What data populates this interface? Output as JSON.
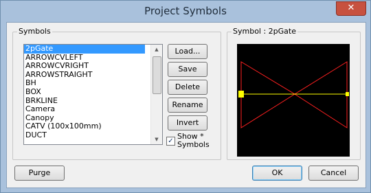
{
  "window": {
    "title": "Project Symbols",
    "close_glyph": "✕"
  },
  "symbols_group": {
    "label": "Symbols",
    "items": [
      "2pGate",
      "ARROWCVLEFT",
      "ARROWCVRIGHT",
      "ARROWSTRAIGHT",
      "BH",
      "BOX",
      "BRKLINE",
      "Camera",
      "Canopy",
      "CATV (100x100mm)",
      "DUCT"
    ],
    "selected": "2pGate"
  },
  "buttons": {
    "load": "Load...",
    "save": "Save",
    "delete": "Delete",
    "rename": "Rename",
    "invert": "Invert",
    "purge": "Purge",
    "ok": "OK",
    "cancel": "Cancel"
  },
  "show_symbols": {
    "label_line1": "Show *",
    "label_line2": "Symbols",
    "checked": true,
    "check_glyph": "✓"
  },
  "preview_group": {
    "label": "Symbol : 2pGate"
  },
  "colors": {
    "preview_bg": "#000000",
    "symbol_outline": "#ff2020",
    "symbol_axis": "#ffff00",
    "selection": "#3399ff"
  }
}
